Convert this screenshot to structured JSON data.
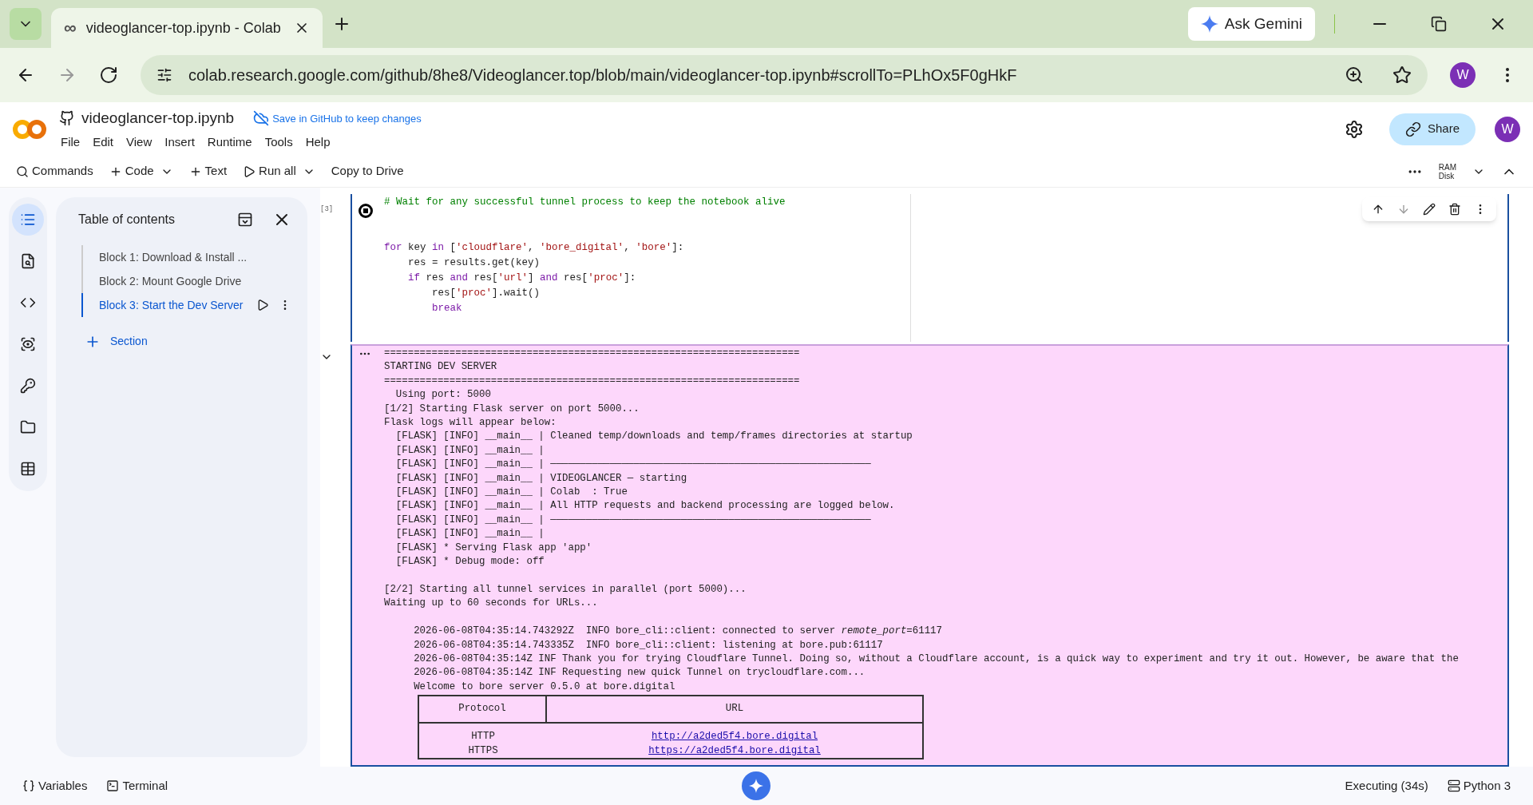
{
  "browser": {
    "tab_icon": "∞",
    "tab_title": "videoglancer-top.ipynb - Colab",
    "ask_button": "Ask Gemini",
    "url": "colab.research.google.com/github/8he8/Videoglancer.top/blob/main/videoglancer-top.ipynb#scrollTo=PLhOx5F0gHkF",
    "profile": "W"
  },
  "notebook": {
    "title": "videoglancer-top.ipynb",
    "save_note": "Save in GitHub to keep changes",
    "share": "Share",
    "profile": "W",
    "menu": [
      "File",
      "Edit",
      "View",
      "Insert",
      "Runtime",
      "Tools",
      "Help"
    ]
  },
  "toolbar": {
    "items": [
      {
        "kind": "search",
        "label": "Commands"
      },
      {
        "kind": "add",
        "label": "Code",
        "dropdown": true
      },
      {
        "kind": "add",
        "label": "Text",
        "dropdown": false
      },
      {
        "kind": "run",
        "label": "Run all",
        "dropdown": true
      },
      {
        "kind": "plain",
        "label": "Copy to Drive",
        "dropdown": false
      }
    ],
    "ram": "RAM",
    "disk": "Disk"
  },
  "rail": [
    {
      "kind": "toc",
      "selected": true
    },
    {
      "kind": "find",
      "selected": false
    },
    {
      "kind": "code",
      "selected": false
    },
    {
      "kind": "eye",
      "selected": false
    },
    {
      "kind": "key",
      "selected": false
    },
    {
      "kind": "folder",
      "selected": false
    },
    {
      "kind": "table",
      "selected": false
    }
  ],
  "toc": {
    "title": "Table of contents",
    "items": [
      {
        "label": "Block 1: Download & Install ...",
        "selected": false
      },
      {
        "label": "Block 2: Mount Google Drive",
        "selected": false
      },
      {
        "label": "Block 3: Start the Dev Server",
        "selected": true
      }
    ],
    "add_section": "Section"
  },
  "cell": {
    "exec_count": "[3]",
    "code_blocks": [
      [
        [
          {
            "kind": "comment",
            "text": "# Wait for any successful tunnel process to keep the notebook alive"
          }
        ]
      ],
      [
        [
          {
            "kind": "keyword",
            "text": "for"
          },
          {
            "kind": "plain",
            "text": " key "
          },
          {
            "kind": "keyword",
            "text": "in"
          },
          {
            "kind": "plain",
            "text": " ["
          },
          {
            "kind": "string",
            "text": "'cloudflare'"
          },
          {
            "kind": "plain",
            "text": ", "
          },
          {
            "kind": "string",
            "text": "'bore_digital'"
          },
          {
            "kind": "plain",
            "text": ", "
          },
          {
            "kind": "string",
            "text": "'bore'"
          },
          {
            "kind": "plain",
            "text": "]:"
          }
        ],
        [
          {
            "kind": "plain",
            "text": "    res = results.get(key)"
          }
        ],
        [
          {
            "kind": "keyword",
            "text": "    if"
          },
          {
            "kind": "plain",
            "text": " res "
          },
          {
            "kind": "keyword",
            "text": "and"
          },
          {
            "kind": "plain",
            "text": " res["
          },
          {
            "kind": "string",
            "text": "'url'"
          },
          {
            "kind": "plain",
            "text": "] "
          },
          {
            "kind": "keyword",
            "text": "and"
          },
          {
            "kind": "plain",
            "text": " res["
          },
          {
            "kind": "string",
            "text": "'proc'"
          },
          {
            "kind": "plain",
            "text": "]:"
          }
        ],
        [
          {
            "kind": "plain",
            "text": "        res["
          },
          {
            "kind": "string",
            "text": "'proc'"
          },
          {
            "kind": "plain",
            "text": "].wait()"
          }
        ],
        [
          {
            "kind": "keyword",
            "text": "        break"
          }
        ]
      ]
    ]
  },
  "output": {
    "blocks": [
      [
        "======================================================================",
        "STARTING DEV SERVER",
        "======================================================================",
        "  Using port: 5000",
        "[1/2] Starting Flask server on port 5000...",
        "Flask logs will appear below:",
        "  [FLASK] [INFO] __main__ | Cleaned temp/downloads and temp/frames directories at startup",
        "  [FLASK] [INFO] __main__ |",
        "  [FLASK] [INFO] __main__ | ──────────────────────────────────────────────────────",
        "  [FLASK] [INFO] __main__ | VIDEOGLANCER — starting",
        "  [FLASK] [INFO] __main__ | Colab  : True",
        "  [FLASK] [INFO] __main__ | All HTTP requests and backend processing are logged below.",
        "  [FLASK] [INFO] __main__ | ──────────────────────────────────────────────────────",
        "  [FLASK] [INFO] __main__ |",
        "  [FLASK] * Serving Flask app 'app'",
        "  [FLASK] * Debug mode: off"
      ],
      [
        "[2/2] Starting all tunnel services in parallel (port 5000)...",
        "Waiting up to 60 seconds for URLs..."
      ],
      [
        "     2026-06-08T04:35:14.743292Z  INFO bore_cli::client: connected to server *remote_port*=61117",
        "     2026-06-08T04:35:14.743335Z  INFO bore_cli::client: listening at bore.pub:61117",
        "     2026-06-08T04:35:14Z INF Thank you for trying Cloudflare Tunnel. Doing so, without a Cloudflare account, is a quick way to experiment and try it out. However, be aware that the",
        "     2026-06-08T04:35:14Z INF Requesting new quick Tunnel on trycloudflare.com...",
        "     Welcome to bore server 0.5.0 at bore.digital"
      ]
    ],
    "table": {
      "columns": [
        "Protocol",
        "URL"
      ],
      "rows": [
        [
          "HTTP",
          "http://a2ded5f4.bore.digital"
        ],
        [
          "HTTPS",
          "https://a2ded5f4.bore.digital"
        ]
      ]
    }
  },
  "status_bar": {
    "variables": "Variables",
    "terminal": "Terminal",
    "executing": "Executing (34s)",
    "runtime": "Python 3"
  }
}
